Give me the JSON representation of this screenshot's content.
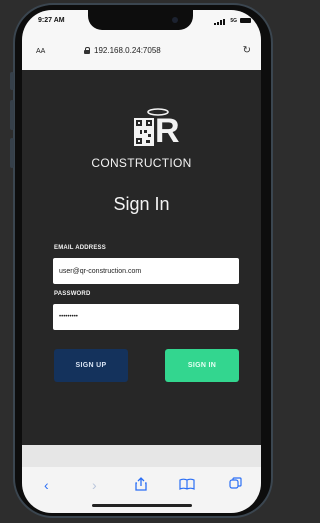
{
  "status": {
    "time": "9:27 AM",
    "network": "5G"
  },
  "browser": {
    "text_size": "AA",
    "url": "192.168.0.24:7058"
  },
  "brand": {
    "logo_letter": "R",
    "name": "CONSTRUCTION"
  },
  "form": {
    "title": "Sign In",
    "email_label": "EMAIL ADDRESS",
    "email_value": "user@qr-construction.com",
    "password_label": "PASSWORD",
    "password_value": "•••••••••",
    "signup_label": "SIGN UP",
    "signin_label": "SIGN IN"
  },
  "colors": {
    "background": "#272727",
    "signup": "#14325c",
    "signin": "#33d68f",
    "link": "#2a6ef5"
  },
  "icons": [
    "lock-icon",
    "reload-icon",
    "back-icon",
    "forward-icon",
    "share-icon",
    "bookmarks-icon",
    "tabs-icon"
  ]
}
